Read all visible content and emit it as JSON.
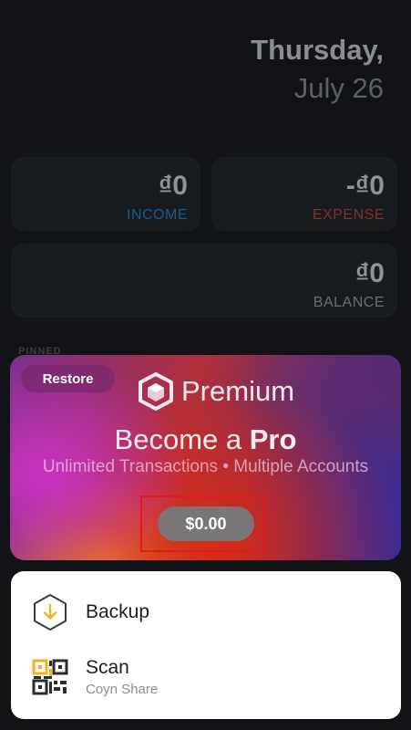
{
  "date": {
    "weekday": "Thursday,",
    "month_day": "July 26"
  },
  "summary": {
    "income": {
      "amount": "₫0",
      "label": "INCOME"
    },
    "expense": {
      "amount": "-₫0",
      "label": "EXPENSE"
    },
    "balance": {
      "amount": "₫0",
      "label": "BALANCE"
    }
  },
  "pinned_label": "PINNED",
  "promo": {
    "restore_label": "Restore",
    "brand": "Premium",
    "headline_prefix": "Become a ",
    "headline_emphasis": "Pro",
    "features": "Unlimited Transactions • Multiple Accounts",
    "price": "$0.00"
  },
  "actions": {
    "backup": {
      "title": "Backup",
      "icon": "download-icon"
    },
    "scan": {
      "title": "Scan",
      "subtitle": "Coyn Share",
      "icon": "qr-code-icon"
    }
  },
  "colors": {
    "background": "#111317",
    "income": "#1e5a86",
    "expense": "#84302e",
    "highlight": "#e21a1a",
    "backup_accent": "#f2b21f"
  }
}
